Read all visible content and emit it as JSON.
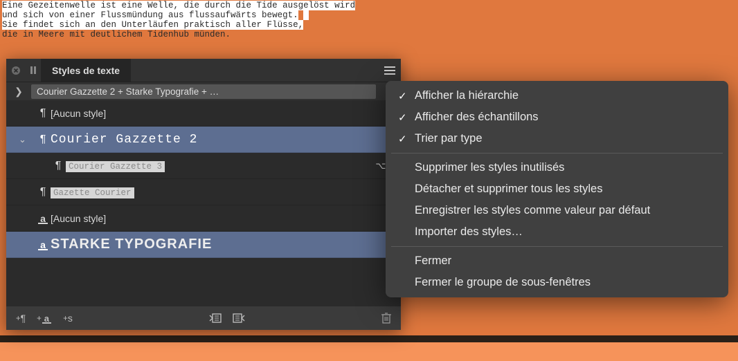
{
  "document": {
    "line1": "Eine Gezeitenwelle ist eine Welle, die durch die Tide ausgelöst wird",
    "line2": "und sich von einer Flussmündung aus flussaufwärts bewegt.",
    "line3": "Sie findet sich an den Unterläufen praktisch aller Flüsse,",
    "line4": "die in Meere mit deutlichem Tidenhub münden."
  },
  "panel": {
    "title": "Styles de texte",
    "breadcrumb": "Courier Gazzette 2 + Starke Typografie + …",
    "styles": [
      {
        "type": "paragraph",
        "label": "[Aucun style]",
        "indent": 0,
        "selected": false,
        "boxed": false
      },
      {
        "type": "paragraph",
        "label": "Courier Gazzette 2",
        "indent": 0,
        "selected": true,
        "boxed": false,
        "disclose": true,
        "font": "courier"
      },
      {
        "type": "paragraph",
        "label": "Courier Gazzette 3",
        "indent": 2,
        "selected": false,
        "boxed": true,
        "shortcut": "⌥,"
      },
      {
        "type": "paragraph",
        "label": "Gazette Courier",
        "indent": 1,
        "selected": false,
        "boxed": true
      },
      {
        "type": "character",
        "label": "[Aucun style]",
        "indent": 0,
        "selected": false,
        "boxed": false
      },
      {
        "type": "character",
        "label": "STARKE TYPOGRAFIE",
        "indent": 0,
        "selected": true,
        "boxed": false,
        "font": "starke"
      }
    ],
    "footer": {
      "add_para": "+¶",
      "add_char": "+a",
      "add_style": "+s"
    }
  },
  "menu": {
    "items": [
      {
        "label": "Afficher la hiérarchie",
        "checked": true
      },
      {
        "label": "Afficher des échantillons",
        "checked": true
      },
      {
        "label": "Trier par type",
        "checked": true
      },
      {
        "separator": true
      },
      {
        "label": "Supprimer les styles inutilisés"
      },
      {
        "label": "Détacher et supprimer tous les styles"
      },
      {
        "label": "Enregistrer les styles comme valeur par défaut"
      },
      {
        "label": "Importer des styles…"
      },
      {
        "separator": true
      },
      {
        "label": "Fermer"
      },
      {
        "label": "Fermer le groupe de sous-fenêtres"
      }
    ]
  }
}
